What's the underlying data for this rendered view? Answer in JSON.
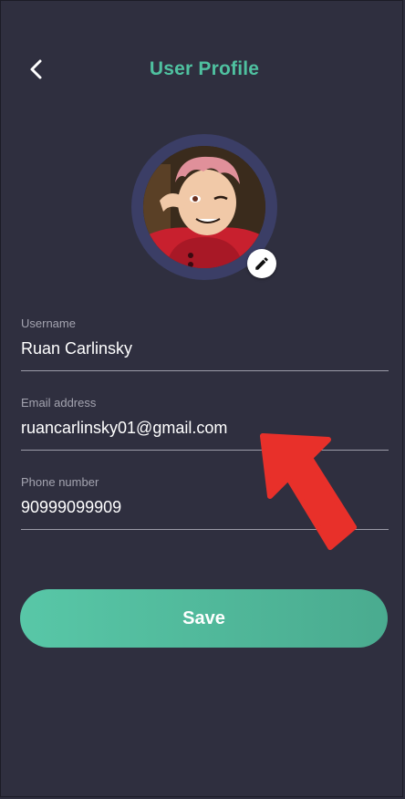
{
  "header": {
    "title": "User Profile",
    "back_icon": "chevron-left-icon"
  },
  "avatar": {
    "edit_icon": "pencil-icon"
  },
  "form": {
    "username": {
      "label": "Username",
      "value": "Ruan Carlinsky"
    },
    "email": {
      "label": "Email address",
      "value": "ruancarlinsky01@gmail.com"
    },
    "phone": {
      "label": "Phone number",
      "value": "90999099909"
    }
  },
  "actions": {
    "save_label": "Save"
  },
  "colors": {
    "background": "#2f2f3f",
    "accent": "#4fc1a0",
    "avatar_ring": "#3b3e66",
    "annotation_arrow": "#e8302a"
  }
}
